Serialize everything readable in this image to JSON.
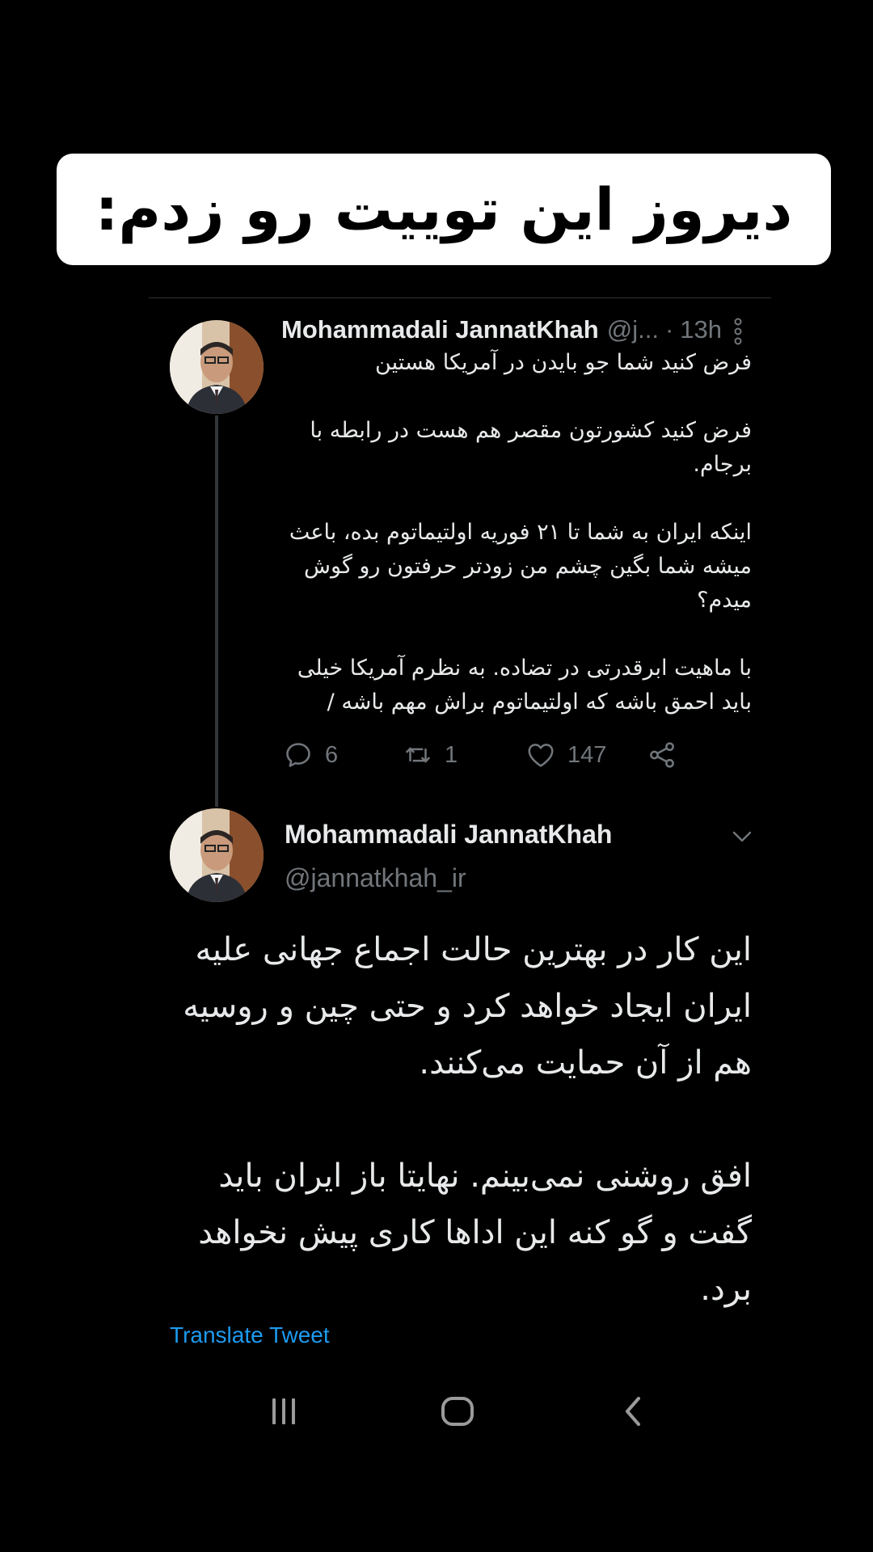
{
  "caption": {
    "text": "دیروز این توییت رو زدم:"
  },
  "tweet1": {
    "author_name": "Mohammadali JannatKhah",
    "author_handle": "@j...",
    "separator": "·",
    "time": "13h",
    "body_paragraphs": [
      "فرض کنید شما جو بایدن در آمریکا هستین",
      "فرض کنید کشورتون مقصر هم هست در رابطه با برجام.",
      "اینکه ایران به شما تا ۲۱ فوریه اولتیماتوم بده، باعث میشه شما بگین چشم من زودتر حرفتون رو گوش میدم؟",
      "با ماهیت ابرقدرتی در تضاده. به نظرم آمریکا خیلی باید احمق باشه که اولتیماتوم براش مهم باشه /"
    ],
    "replies": "6",
    "retweets": "1",
    "likes": "147"
  },
  "tweet2": {
    "author_name": "Mohammadali JannatKhah",
    "author_handle": "@jannatkhah_ir",
    "body_paragraphs": [
      "این کار در بهترین حالت اجماع جهانی علیه ایران ایجاد خواهد کرد و حتی چین و روسیه هم از آن حمایت می‌کنند.",
      "افق روشنی نمی‌بینم. نهایتا باز ایران باید گفت و گو کنه این اداها کاری پیش نخواهد برد."
    ],
    "translate_label": "Translate Tweet"
  },
  "nav": {
    "recent_icon": "recent-apps-icon",
    "home_icon": "home-icon",
    "back_icon": "back-icon"
  },
  "colors": {
    "background": "#000000",
    "text_primary": "#e7e9ea",
    "text_secondary": "#71767b",
    "link": "#1d9bf0",
    "caption_bg": "#ffffff"
  }
}
